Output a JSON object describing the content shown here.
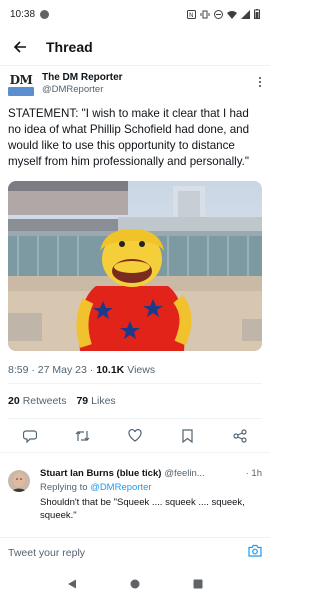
{
  "status_bar": {
    "time": "10:38"
  },
  "header": {
    "title": "Thread"
  },
  "tweet": {
    "avatar_text": "DM",
    "display_name": "The DM Reporter",
    "handle": "@DMReporter",
    "text": "STATEMENT: \"I wish to make it clear that I had no idea of what Phillip Schofield had done, and would like to use this opportunity to distance myself from him professionally and personally.\"",
    "timestamp": "8:59 · 27 May 23 · ",
    "views_count": "10.1K",
    "views_label": "Views",
    "retweets_count": "20",
    "retweets_label": "Retweets",
    "likes_count": "79",
    "likes_label": "Likes"
  },
  "reply": {
    "display_name": "Stuart Ian Burns (blue tick)",
    "handle": "@feelin...",
    "time": "· 1h",
    "replying_prefix": "Replying to ",
    "replying_handle": "@DMReporter",
    "text": "Shouldn't that be \"Squeek .... squeek .... squeek, squeek.\""
  },
  "compose": {
    "placeholder": "Tweet your reply"
  },
  "colors": {
    "accent": "#1d9bf0",
    "muted": "#536471",
    "text": "#0f1419"
  },
  "icons": [
    "back-arrow-icon",
    "more-options-icon",
    "reply-icon",
    "retweet-icon",
    "like-icon",
    "bookmark-icon",
    "share-icon",
    "camera-icon"
  ]
}
